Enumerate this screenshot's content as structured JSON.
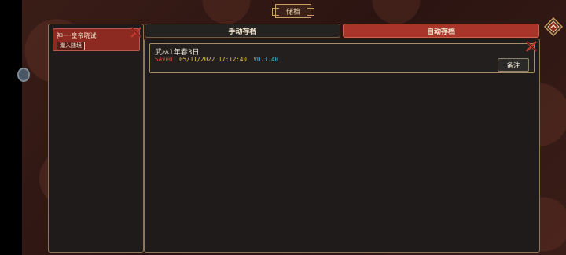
{
  "header": {
    "title": "储档"
  },
  "left_panel": {
    "card": {
      "title": "神一·皇帝晓试",
      "button_label": "潮入随境"
    }
  },
  "tabs": [
    {
      "label": "手动存档",
      "active": false
    },
    {
      "label": "自动存档",
      "active": true
    }
  ],
  "save_entry": {
    "name": "武林1年春3日",
    "slot": "Save0",
    "datetime": "05/11/2022 17:12:40",
    "version": "V0.3.40",
    "note_button": "备注"
  },
  "colors": {
    "accent_red": "#a8342a",
    "border_gold": "#8e7656",
    "slot_red": "#e0463a",
    "date_yellow": "#e8c84a",
    "version_blue": "#4ab8e8"
  }
}
